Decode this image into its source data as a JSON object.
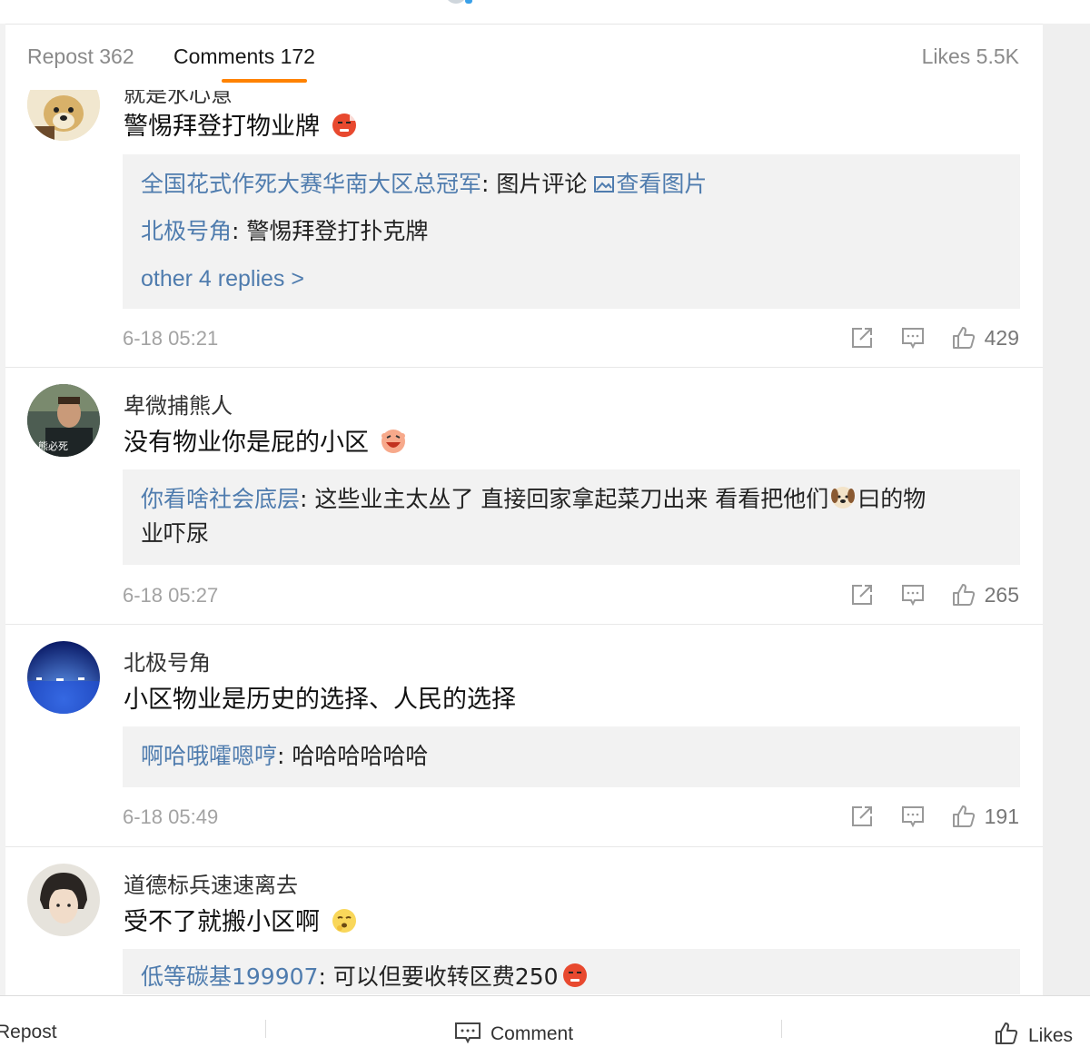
{
  "tabs": {
    "repost": "Repost 362",
    "comments": "Comments 172",
    "likes": "Likes 5.5K"
  },
  "comments": [
    {
      "author": "就是水心意",
      "text": "警惕拜登打物业牌",
      "emoji": "angry-face-emoji",
      "replies": [
        {
          "name": "全国花式作死大赛华南大区总冠军",
          "text": ": 图片评论 ",
          "link": "查看图片"
        },
        {
          "name": "北极号角",
          "text": ": 警惕拜登打扑克牌"
        }
      ],
      "more": "other 4 replies >",
      "time": "6-18 05:21",
      "likes": "429"
    },
    {
      "author": "卑微捕熊人",
      "text": "没有物业你是屁的小区",
      "emoji": "laughing-face-emoji",
      "avatar_caption": "熊必死",
      "replies": [
        {
          "name": "你看啥社会底层",
          "text": ": 这些业主太丛了 直接回家拿起菜刀出来 看看把他们",
          "text2": "曰的物",
          "line2": "业吓尿"
        }
      ],
      "time": "6-18 05:27",
      "likes": "265"
    },
    {
      "author": "北极号角",
      "text": "小区物业是历史的选择、人民的选择",
      "replies": [
        {
          "name": "啊哈哦嚯嗯哼",
          "text": ": 哈哈哈哈哈哈"
        }
      ],
      "time": "6-18 05:49",
      "likes": "191"
    },
    {
      "author": "道德标兵速速离去",
      "text": "受不了就搬小区啊",
      "emoji": "yawning-face-emoji",
      "replies": [
        {
          "name": "低等碳基199907",
          "text": ": 可以但要收转区费250"
        }
      ]
    }
  ],
  "bottombar": {
    "repost": "Repost",
    "comment": "Comment",
    "likes": "Likes"
  },
  "colors": {
    "accent": "#ff8200",
    "link": "#4f7cae",
    "reply_bg": "#f2f2f2",
    "meta": "#a3a3a3"
  }
}
